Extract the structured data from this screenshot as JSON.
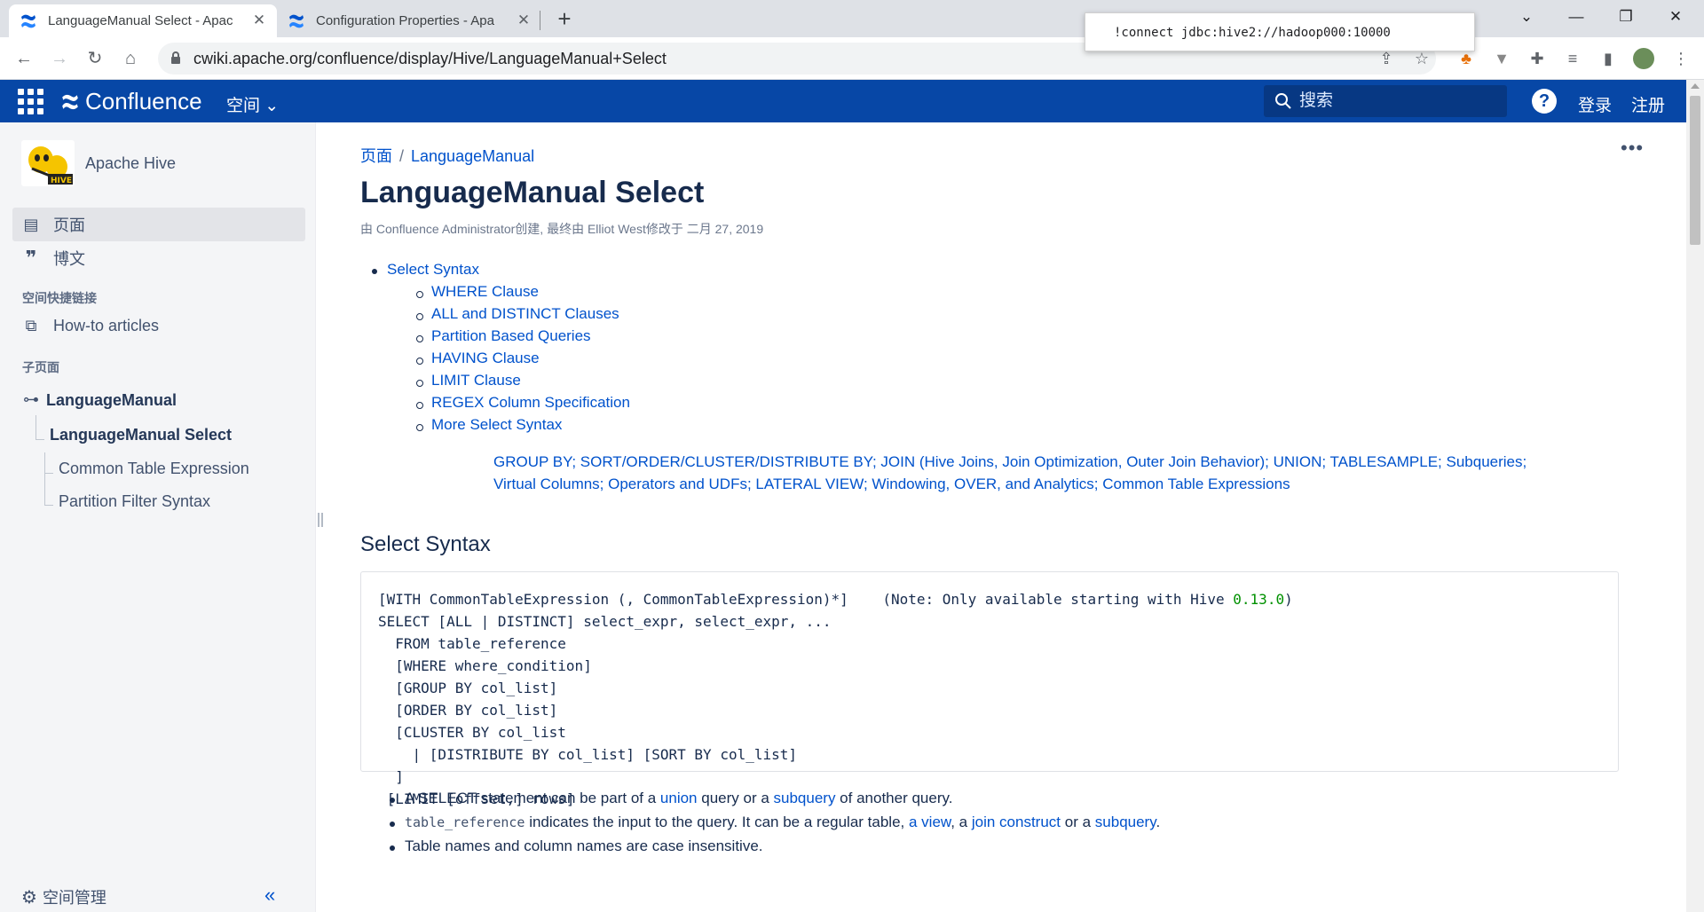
{
  "browser": {
    "tabs": [
      {
        "title": "LanguageManual Select - Apac",
        "active": true
      },
      {
        "title": "Configuration Properties - Apa",
        "active": false
      }
    ],
    "url": "cwiki.apache.org/confluence/display/Hive/LanguageManual+Select",
    "tooltip": "!connect jdbc:hive2://hadoop000:10000"
  },
  "header": {
    "logo": "Confluence",
    "spaces_menu": "空间",
    "search_placeholder": "搜索",
    "help": "?",
    "login": "登录",
    "signup": "注册",
    "brand_color": "#0747a6"
  },
  "sidebar": {
    "space_name": "Apache Hive",
    "nav": [
      {
        "label": "页面",
        "icon": "pages-icon",
        "active": true
      },
      {
        "label": "博文",
        "icon": "quote-icon",
        "active": false
      }
    ],
    "shortcuts_heading": "空间快捷链接",
    "shortcuts": [
      {
        "label": "How-to articles"
      }
    ],
    "children_heading": "子页面",
    "tree": {
      "parent": "LanguageManual",
      "current": "LanguageManual Select",
      "children": [
        "Common Table Expression",
        "Partition Filter Syntax"
      ]
    },
    "space_admin": "空间管理",
    "logo_text": "HIVE"
  },
  "page": {
    "breadcrumbs": [
      "页面",
      "LanguageManual"
    ],
    "title": "LanguageManual Select",
    "meta": "由 Confluence Administrator创建, 最终由 Elliot West修改于 二月 27, 2019",
    "toc": {
      "top": "Select Syntax",
      "items": [
        "WHERE Clause",
        "ALL and DISTINCT Clauses",
        "Partition Based Queries",
        "HAVING Clause",
        "LIMIT Clause",
        "REGEX Column Specification",
        "More Select Syntax"
      ]
    },
    "more_syntax_links": "GROUP BY; SORT/ORDER/CLUSTER/DISTRIBUTE BY; JOIN (Hive Joins, Join Optimization, Outer Join Behavior); UNION; TABLESAMPLE; Subqueries; Virtual Columns; Operators and UDFs; LATERAL VIEW; Windowing, OVER, and Analytics; Common Table Expressions",
    "section_title": "Select Syntax",
    "code_lines": {
      "l1a": "[WITH CommonTableExpression (, CommonTableExpression)*]    (Note: Only available starting with Hive ",
      "l1num": "0.13.0",
      "l1b": ")",
      "l2": "SELECT [ALL | DISTINCT] select_expr, select_expr, ...",
      "l3": "  FROM table_reference",
      "l4": "  [WHERE where_condition]",
      "l5": "  [GROUP BY col_list]",
      "l6": "  [ORDER BY col_list]",
      "l7": "  [CLUSTER BY col_list",
      "l8": "    | [DISTRIBUTE BY col_list] [SORT BY col_list]",
      "l9": "  ]",
      "l10": " [LIMIT [offset,] rows]"
    },
    "bullets": {
      "b1": {
        "t1": "A SELECT statement can be part of a ",
        "link1": "union",
        "t2": " query or a ",
        "link2": "subquery",
        "t3": " of another query."
      },
      "b2": {
        "code": "table_reference",
        "t1": " indicates the input to the query. It can be a regular table, ",
        "link1": "a view",
        "t2": ", a ",
        "link2": "join construct",
        "t3": " or a ",
        "link3": "subquery",
        "t4": "."
      },
      "b3": {
        "t1": "Table names and column names are case insensitive."
      }
    }
  }
}
